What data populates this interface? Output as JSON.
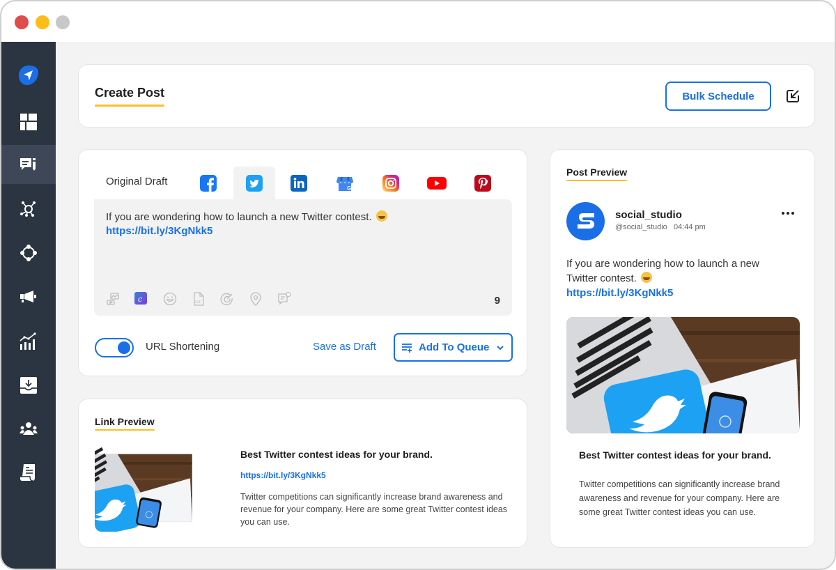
{
  "window": {
    "controls": [
      "close",
      "minimize",
      "maximize"
    ]
  },
  "sidebar": {
    "items": [
      {
        "name": "logo",
        "icon": "paper-plane-icon",
        "active": false
      },
      {
        "name": "dashboard",
        "icon": "dashboard-grid-icon",
        "active": false
      },
      {
        "name": "compose",
        "icon": "compose-message-icon",
        "active": true
      },
      {
        "name": "network",
        "icon": "network-hub-icon",
        "active": false
      },
      {
        "name": "workflow",
        "icon": "nodes-circle-icon",
        "active": false
      },
      {
        "name": "campaigns",
        "icon": "megaphone-icon",
        "active": false
      },
      {
        "name": "analytics",
        "icon": "analytics-chart-icon",
        "active": false
      },
      {
        "name": "inbox",
        "icon": "inbox-download-icon",
        "active": false
      },
      {
        "name": "team",
        "icon": "team-users-icon",
        "active": false
      },
      {
        "name": "reports",
        "icon": "report-scroll-icon",
        "active": false
      }
    ]
  },
  "header": {
    "title": "Create Post",
    "bulk_schedule_label": "Bulk Schedule",
    "export_icon": "export-arrow-icon"
  },
  "composer": {
    "original_draft_label": "Original Draft",
    "networks": [
      {
        "name": "facebook",
        "active": false,
        "color": "#1877f2"
      },
      {
        "name": "twitter",
        "active": true,
        "color": "#1da1f2"
      },
      {
        "name": "linkedin",
        "active": false,
        "color": "#0a66c2"
      },
      {
        "name": "google-business",
        "active": false,
        "color": "#4285f4"
      },
      {
        "name": "instagram",
        "active": false,
        "color": "#e1306c"
      },
      {
        "name": "youtube",
        "active": false,
        "color": "#ff0000"
      },
      {
        "name": "pinterest",
        "active": false,
        "color": "#bd081c"
      }
    ],
    "text": "If you are wondering how to launch a new Twitter contest.",
    "link": "https://bit.ly/3KgNkk5",
    "tools": [
      "media-library-icon",
      "canva-icon",
      "emoji-icon",
      "gif-icon",
      "target-icon",
      "location-icon",
      "comment-icon"
    ],
    "char_count": "9",
    "url_shortening_label": "URL Shortening",
    "url_shortening_on": true,
    "save_draft_label": "Save as Draft",
    "add_queue_label": "Add To Queue"
  },
  "link_preview": {
    "section_title": "Link Preview",
    "title": "Best Twitter contest ideas for your brand.",
    "url": "https://bit.ly/3KgNkk5",
    "description": "Twitter competitions can significantly increase brand awareness and revenue for your company. Here are some great Twitter contest ideas you can use."
  },
  "post_preview": {
    "section_title": "Post Preview",
    "account_name": "social_studio",
    "handle": "@social_studio",
    "time": "04:44 pm",
    "text": "If you are wondering how to launch a new Twitter contest.",
    "link": "https://bit.ly/3KgNkk5",
    "card_title": "Best Twitter contest ideas for your brand.",
    "card_description": "Twitter competitions can significantly increase brand awareness and revenue for your company. Here are some great Twitter contest ideas you can use."
  },
  "colors": {
    "accent": "#1a6fe6",
    "highlight": "#fbbf24",
    "sidebar": "#2b3441"
  }
}
